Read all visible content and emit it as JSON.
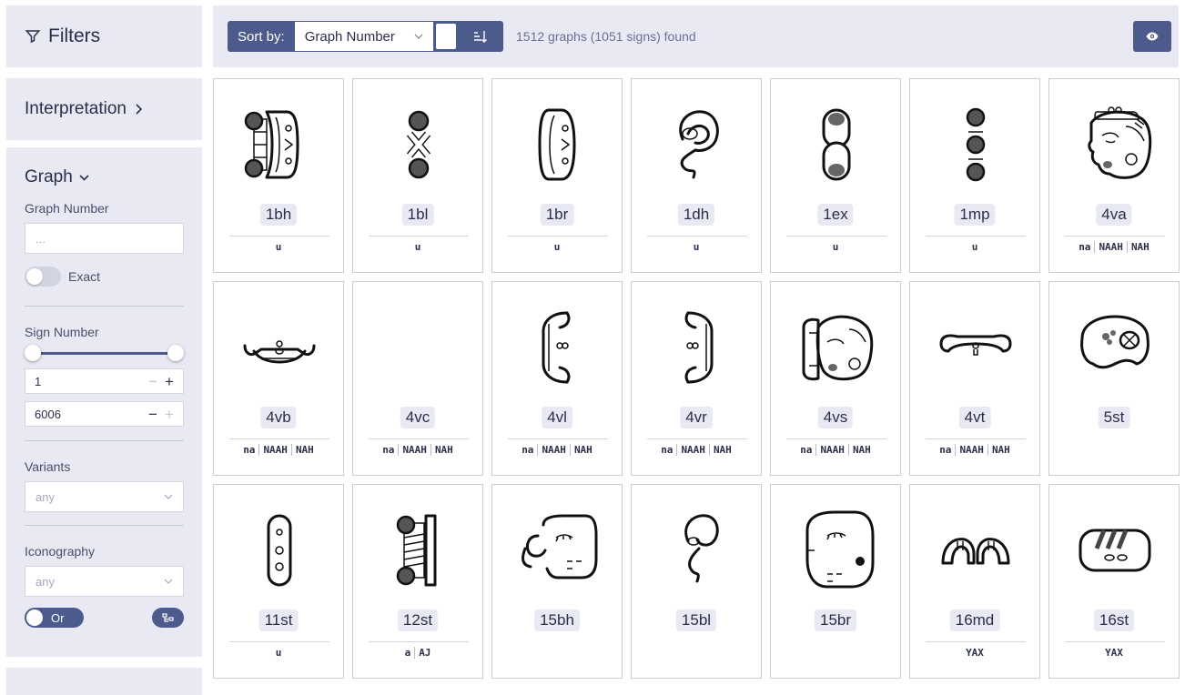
{
  "sidebar": {
    "filters_title": "Filters",
    "interpretation_title": "Interpretation",
    "graph_title": "Graph",
    "graph_number_label": "Graph Number",
    "graph_number_placeholder": "...",
    "exact_label": "Exact",
    "sign_number_label": "Sign Number",
    "sign_min": "1",
    "sign_max": "6006",
    "sign_range_fraction": [
      0,
      1
    ],
    "variants_label": "Variants",
    "variants_value": "any",
    "iconography_label": "Iconography",
    "iconography_value": "any",
    "or_label": "Or"
  },
  "toolbar": {
    "sort_label": "Sort by:",
    "sort_value": "Graph Number",
    "result_count": "1512 graphs (1051 signs) found"
  },
  "cards": [
    {
      "code": "1bh",
      "readings": [
        "u"
      ],
      "glyph": "bh"
    },
    {
      "code": "1bl",
      "readings": [
        "u"
      ],
      "glyph": "bl"
    },
    {
      "code": "1br",
      "readings": [
        "u"
      ],
      "glyph": "br"
    },
    {
      "code": "1dh",
      "readings": [
        "u"
      ],
      "glyph": "dh"
    },
    {
      "code": "1ex",
      "readings": [
        "u"
      ],
      "glyph": "ex"
    },
    {
      "code": "1mp",
      "readings": [
        "u"
      ],
      "glyph": "mp"
    },
    {
      "code": "4va",
      "readings": [
        "na",
        "NAAH",
        "NAH"
      ],
      "glyph": "head"
    },
    {
      "code": "4vb",
      "readings": [
        "na",
        "NAAH",
        "NAH"
      ],
      "glyph": "vb"
    },
    {
      "code": "4vc",
      "readings": [
        "na",
        "NAAH",
        "NAH"
      ],
      "glyph": "head2"
    },
    {
      "code": "4vl",
      "readings": [
        "na",
        "NAAH",
        "NAH"
      ],
      "glyph": "vl"
    },
    {
      "code": "4vr",
      "readings": [
        "na",
        "NAAH",
        "NAH"
      ],
      "glyph": "vr"
    },
    {
      "code": "4vs",
      "readings": [
        "na",
        "NAAH",
        "NAH"
      ],
      "glyph": "vs"
    },
    {
      "code": "4vt",
      "readings": [
        "na",
        "NAAH",
        "NAH"
      ],
      "glyph": "vt"
    },
    {
      "code": "5st",
      "readings": [],
      "glyph": "st5"
    },
    {
      "code": "11st",
      "readings": [
        "u"
      ],
      "glyph": "st11"
    },
    {
      "code": "12st",
      "readings": [
        "a",
        "AJ"
      ],
      "glyph": "st12"
    },
    {
      "code": "15bh",
      "readings": [],
      "glyph": "bh15"
    },
    {
      "code": "15bl",
      "readings": [],
      "glyph": "bl15"
    },
    {
      "code": "15br",
      "readings": [],
      "glyph": "br15"
    },
    {
      "code": "16md",
      "readings": [
        "YAX"
      ],
      "glyph": "md16"
    },
    {
      "code": "16st",
      "readings": [
        "YAX"
      ],
      "glyph": "st16"
    }
  ],
  "colors": {
    "accent": "#4c5a8c",
    "panel": "#e8e9f3"
  }
}
